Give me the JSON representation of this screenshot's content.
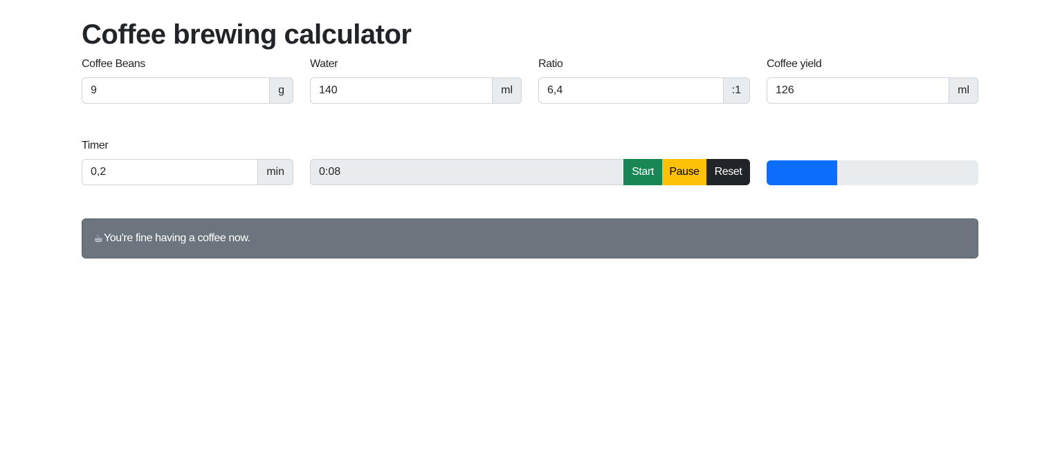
{
  "title": "Coffee brewing calculator",
  "fields": {
    "beans": {
      "label": "Coffee Beans",
      "value": "9",
      "unit": "g"
    },
    "water": {
      "label": "Water",
      "value": "140",
      "unit": "ml"
    },
    "ratio": {
      "label": "Ratio",
      "value": "6,4",
      "unit": ":1"
    },
    "yield": {
      "label": "Coffee yield",
      "value": "126",
      "unit": "ml"
    },
    "timer": {
      "label": "Timer",
      "value": "0,2",
      "unit": "min"
    }
  },
  "timer_display": "0:08",
  "buttons": {
    "start": "Start",
    "pause": "Pause",
    "reset": "Reset"
  },
  "progress_fraction": 0.333,
  "colors": {
    "start": "#198754",
    "pause": "#ffc107",
    "reset": "#212529",
    "progress": "#0d6efd",
    "alert_bg": "#6c757d"
  },
  "alert": {
    "icon": "coffee-cup-icon",
    "icon_glyph": "☕",
    "text": "You're fine having a coffee now."
  }
}
